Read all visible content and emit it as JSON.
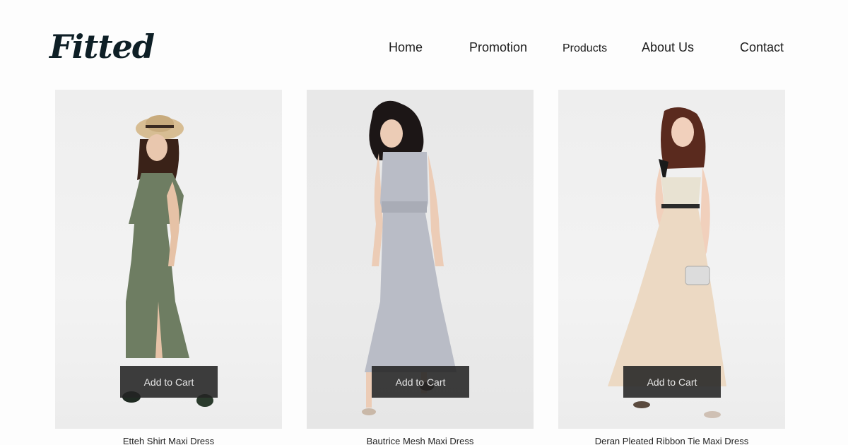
{
  "brand": {
    "logo_text": "Fitted"
  },
  "nav": {
    "items": [
      {
        "label": "Home"
      },
      {
        "label": "Promotion"
      },
      {
        "label": "Products"
      },
      {
        "label": "About Us"
      },
      {
        "label": "Contact"
      }
    ]
  },
  "products": [
    {
      "name": "Etteh Shirt Maxi Dress",
      "cta": "Add to Cart",
      "dress_color": "#6e7d62"
    },
    {
      "name": "Bautrice Mesh Maxi Dress",
      "cta": "Add to Cart",
      "dress_color": "#b9bcc6"
    },
    {
      "name": "Deran Pleated Ribbon Tie Maxi Dress",
      "cta": "Add to Cart",
      "dress_color": "#ecd9c3"
    }
  ],
  "colors": {
    "logo": "#0e1f26",
    "button_bg": "#232323",
    "button_text": "#e6e6e6"
  }
}
